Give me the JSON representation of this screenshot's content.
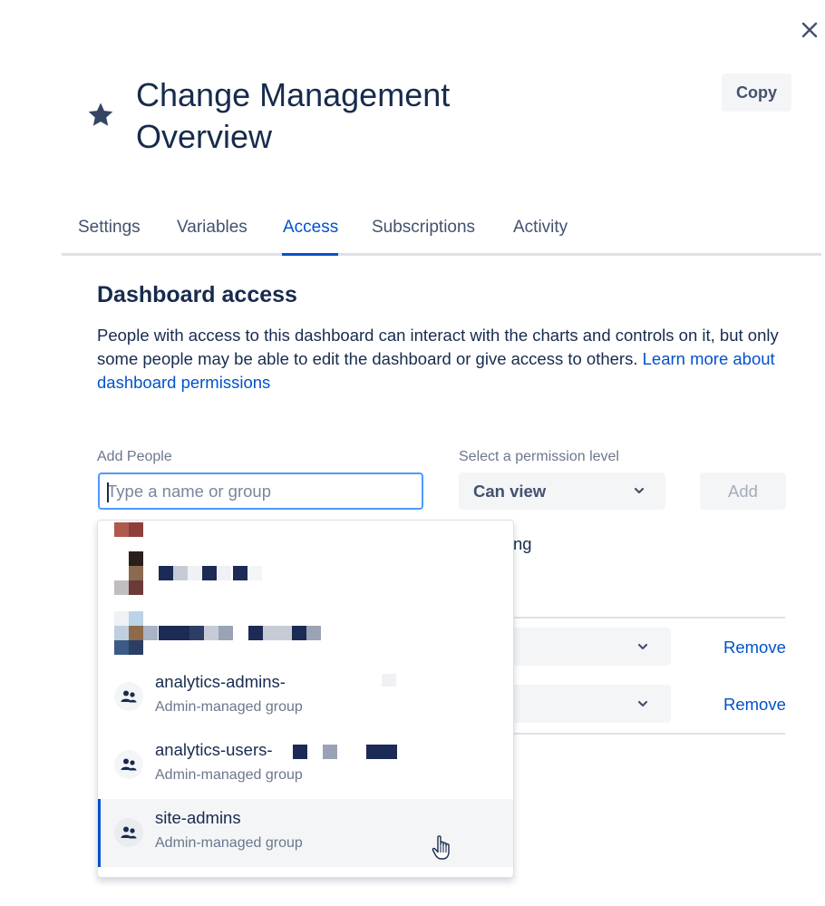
{
  "header": {
    "title_line1": "Change Management",
    "title_line2": "Overview",
    "copy_label": "Copy",
    "close_icon": "close-icon",
    "star_icon": "star-icon"
  },
  "tabs": [
    {
      "label": "Settings",
      "active": false
    },
    {
      "label": "Variables",
      "active": false
    },
    {
      "label": "Access",
      "active": true
    },
    {
      "label": "Subscriptions",
      "active": false
    },
    {
      "label": "Activity",
      "active": false
    }
  ],
  "access": {
    "title": "Dashboard access",
    "description": "People with access to this dashboard can interact with the charts and controls on it, but only some people may be able to edit the dashboard or give access to others.",
    "learn_more": "Learn more about dashboard permissions",
    "add_people_label": "Add People",
    "search_placeholder": "Type a name or group",
    "permission_label": "Select a permission level",
    "permission_value": "Can view",
    "add_label": "Add",
    "partial_text": "ng",
    "remove_label": "Remove"
  },
  "dropdown": {
    "options": [
      {
        "name": "analytics-admins-",
        "subtitle": "Admin-managed group",
        "icon": "group-icon"
      },
      {
        "name": "analytics-users-",
        "subtitle": "Admin-managed group",
        "icon": "group-icon"
      },
      {
        "name": "site-admins",
        "subtitle": "Admin-managed group",
        "icon": "group-icon",
        "selected": true
      }
    ]
  },
  "colors": {
    "accent": "#0052cc",
    "focus_border": "#4c9aff",
    "text": "#172b4d",
    "muted": "#6b778c"
  }
}
